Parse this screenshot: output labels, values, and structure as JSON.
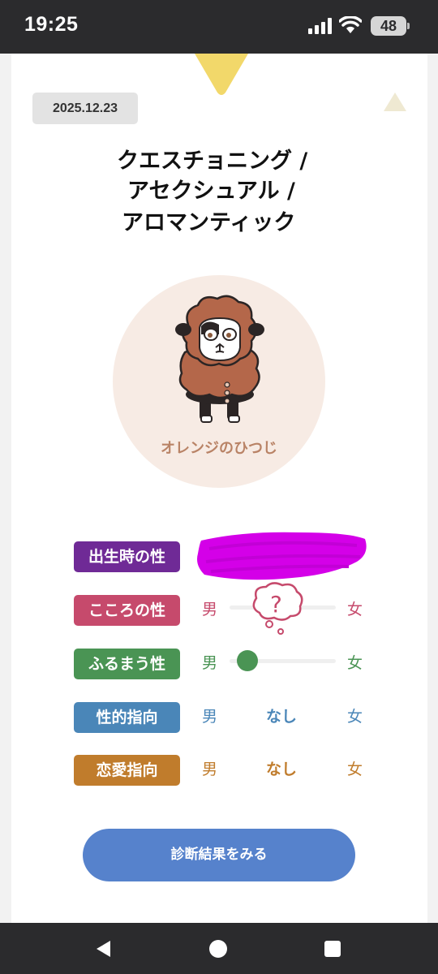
{
  "status_bar": {
    "time": "19:25",
    "battery": "48"
  },
  "result": {
    "date": "2025.12.23",
    "title_lines": [
      "クエスチョニング /",
      "アセクシュアル /",
      "アロマンティック"
    ],
    "character_name": "オレンジのひつじ",
    "rows": [
      {
        "label": "出生時の性",
        "color": "#6f2a96"
      },
      {
        "label": "こころの性",
        "color": "#c64a6c",
        "left": "男",
        "right": "女",
        "marker": "?"
      },
      {
        "label": "ふるまう性",
        "color": "#4a9454",
        "left": "男",
        "right": "女",
        "position": 0.17
      },
      {
        "label": "性的指向",
        "color": "#4a86b8",
        "left": "男",
        "middle": "なし",
        "right": "女"
      },
      {
        "label": "恋愛指向",
        "color": "#c07c2c",
        "left": "男",
        "middle": "なし",
        "right": "女"
      }
    ],
    "cta_label": "診断結果をみる"
  },
  "icons": [
    "signal-icon",
    "wifi-icon",
    "battery-icon",
    "sheep-avatar",
    "question-bubble-icon",
    "back-icon",
    "home-icon",
    "recent-apps-icon"
  ],
  "colors": {
    "cta": "#5682cc",
    "accent_triangle": "#f2d86a",
    "avatar_bg": "#f7ebe4",
    "redaction": "#d400e8"
  }
}
